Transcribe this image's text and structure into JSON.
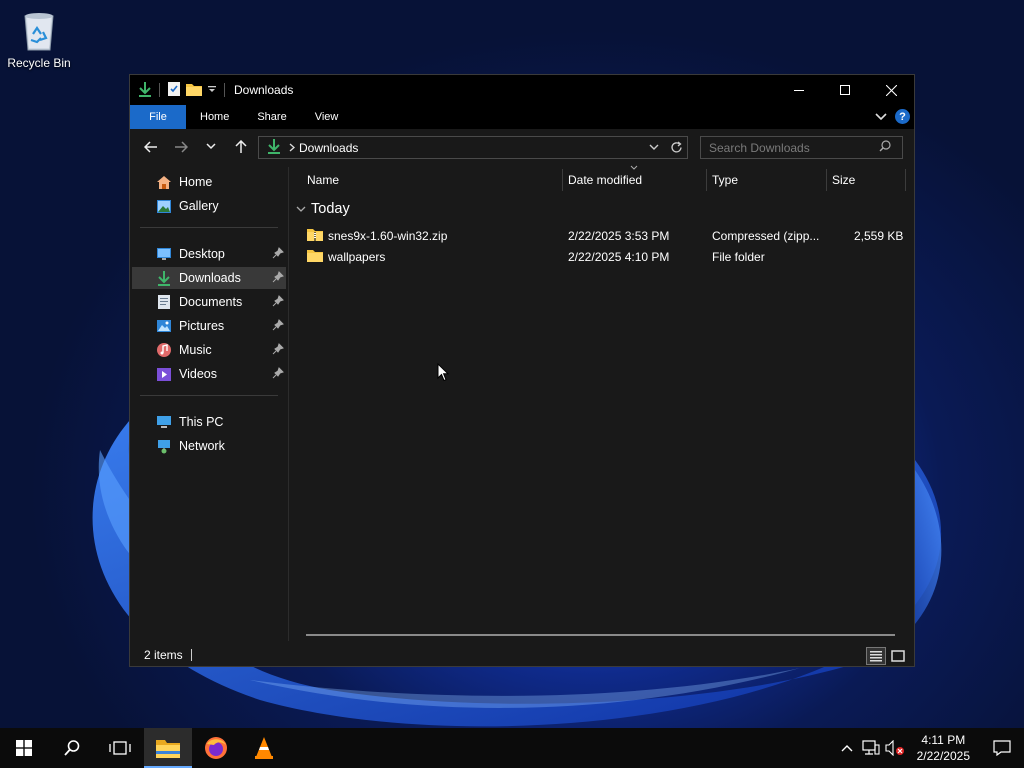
{
  "desktop": {
    "icons": [
      {
        "label": "Recycle Bin",
        "icon": "recycle-bin-icon"
      }
    ]
  },
  "window": {
    "title": "Downloads",
    "controls": {
      "minimize": "minimize-icon",
      "maximize": "maximize-icon",
      "close": "close-icon"
    }
  },
  "ribbon": {
    "tabs": [
      "File",
      "Home",
      "Share",
      "View"
    ],
    "accent": "#1b6ac9"
  },
  "nav": {
    "address_crumb": "Downloads",
    "search_placeholder": "Search Downloads"
  },
  "sidebar": {
    "quick": [
      {
        "label": "Home",
        "icon": "home-icon"
      },
      {
        "label": "Gallery",
        "icon": "gallery-icon"
      }
    ],
    "pinned": [
      {
        "label": "Desktop",
        "icon": "desktop-icon",
        "pinned": true
      },
      {
        "label": "Downloads",
        "icon": "downloads-icon",
        "pinned": true,
        "selected": true
      },
      {
        "label": "Documents",
        "icon": "documents-icon",
        "pinned": true
      },
      {
        "label": "Pictures",
        "icon": "pictures-icon",
        "pinned": true
      },
      {
        "label": "Music",
        "icon": "music-icon",
        "pinned": true
      },
      {
        "label": "Videos",
        "icon": "videos-icon",
        "pinned": true
      }
    ],
    "locations": [
      {
        "label": "This PC",
        "icon": "this-pc-icon"
      },
      {
        "label": "Network",
        "icon": "network-icon"
      }
    ]
  },
  "files": {
    "columns": [
      "Name",
      "Date modified",
      "Type",
      "Size"
    ],
    "group": "Today",
    "rows": [
      {
        "name": "snes9x-1.60-win32.zip",
        "date": "2/22/2025 3:53 PM",
        "type": "Compressed (zipp...",
        "size": "2,559 KB",
        "icon": "zip-folder-icon"
      },
      {
        "name": "wallpapers",
        "date": "2/22/2025 4:10 PM",
        "type": "File folder",
        "size": "",
        "icon": "folder-icon"
      }
    ]
  },
  "status": {
    "count": "2 items"
  },
  "taskbar": {
    "apps": [
      "start-icon",
      "search-icon",
      "task-view-icon",
      "file-explorer-icon",
      "firefox-icon",
      "vlc-icon"
    ],
    "time": "4:11 PM",
    "date": "2/22/2025"
  }
}
